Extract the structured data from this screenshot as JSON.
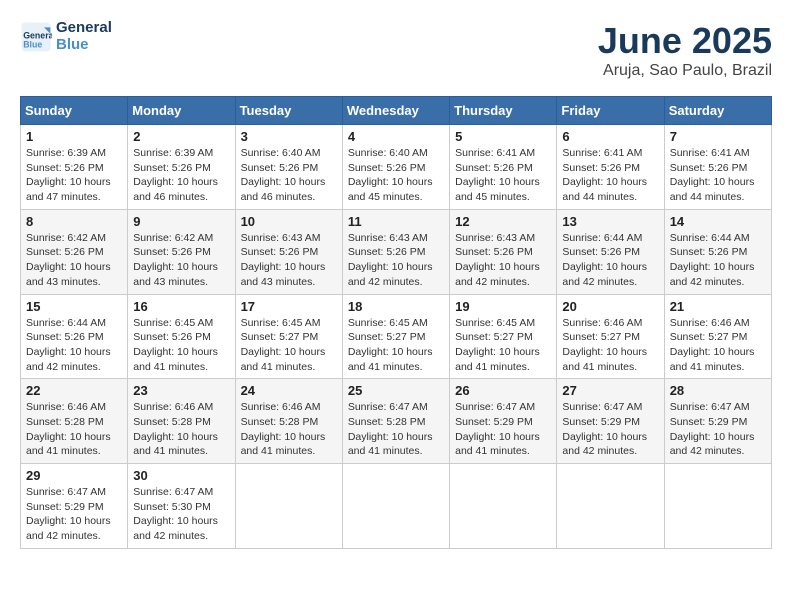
{
  "header": {
    "logo_line1": "General",
    "logo_line2": "Blue",
    "month": "June 2025",
    "location": "Aruja, Sao Paulo, Brazil"
  },
  "days_of_week": [
    "Sunday",
    "Monday",
    "Tuesday",
    "Wednesday",
    "Thursday",
    "Friday",
    "Saturday"
  ],
  "weeks": [
    [
      {
        "day": "1",
        "info": "Sunrise: 6:39 AM\nSunset: 5:26 PM\nDaylight: 10 hours\nand 47 minutes."
      },
      {
        "day": "2",
        "info": "Sunrise: 6:39 AM\nSunset: 5:26 PM\nDaylight: 10 hours\nand 46 minutes."
      },
      {
        "day": "3",
        "info": "Sunrise: 6:40 AM\nSunset: 5:26 PM\nDaylight: 10 hours\nand 46 minutes."
      },
      {
        "day": "4",
        "info": "Sunrise: 6:40 AM\nSunset: 5:26 PM\nDaylight: 10 hours\nand 45 minutes."
      },
      {
        "day": "5",
        "info": "Sunrise: 6:41 AM\nSunset: 5:26 PM\nDaylight: 10 hours\nand 45 minutes."
      },
      {
        "day": "6",
        "info": "Sunrise: 6:41 AM\nSunset: 5:26 PM\nDaylight: 10 hours\nand 44 minutes."
      },
      {
        "day": "7",
        "info": "Sunrise: 6:41 AM\nSunset: 5:26 PM\nDaylight: 10 hours\nand 44 minutes."
      }
    ],
    [
      {
        "day": "8",
        "info": "Sunrise: 6:42 AM\nSunset: 5:26 PM\nDaylight: 10 hours\nand 43 minutes."
      },
      {
        "day": "9",
        "info": "Sunrise: 6:42 AM\nSunset: 5:26 PM\nDaylight: 10 hours\nand 43 minutes."
      },
      {
        "day": "10",
        "info": "Sunrise: 6:43 AM\nSunset: 5:26 PM\nDaylight: 10 hours\nand 43 minutes."
      },
      {
        "day": "11",
        "info": "Sunrise: 6:43 AM\nSunset: 5:26 PM\nDaylight: 10 hours\nand 42 minutes."
      },
      {
        "day": "12",
        "info": "Sunrise: 6:43 AM\nSunset: 5:26 PM\nDaylight: 10 hours\nand 42 minutes."
      },
      {
        "day": "13",
        "info": "Sunrise: 6:44 AM\nSunset: 5:26 PM\nDaylight: 10 hours\nand 42 minutes."
      },
      {
        "day": "14",
        "info": "Sunrise: 6:44 AM\nSunset: 5:26 PM\nDaylight: 10 hours\nand 42 minutes."
      }
    ],
    [
      {
        "day": "15",
        "info": "Sunrise: 6:44 AM\nSunset: 5:26 PM\nDaylight: 10 hours\nand 42 minutes."
      },
      {
        "day": "16",
        "info": "Sunrise: 6:45 AM\nSunset: 5:26 PM\nDaylight: 10 hours\nand 41 minutes."
      },
      {
        "day": "17",
        "info": "Sunrise: 6:45 AM\nSunset: 5:27 PM\nDaylight: 10 hours\nand 41 minutes."
      },
      {
        "day": "18",
        "info": "Sunrise: 6:45 AM\nSunset: 5:27 PM\nDaylight: 10 hours\nand 41 minutes."
      },
      {
        "day": "19",
        "info": "Sunrise: 6:45 AM\nSunset: 5:27 PM\nDaylight: 10 hours\nand 41 minutes."
      },
      {
        "day": "20",
        "info": "Sunrise: 6:46 AM\nSunset: 5:27 PM\nDaylight: 10 hours\nand 41 minutes."
      },
      {
        "day": "21",
        "info": "Sunrise: 6:46 AM\nSunset: 5:27 PM\nDaylight: 10 hours\nand 41 minutes."
      }
    ],
    [
      {
        "day": "22",
        "info": "Sunrise: 6:46 AM\nSunset: 5:28 PM\nDaylight: 10 hours\nand 41 minutes."
      },
      {
        "day": "23",
        "info": "Sunrise: 6:46 AM\nSunset: 5:28 PM\nDaylight: 10 hours\nand 41 minutes."
      },
      {
        "day": "24",
        "info": "Sunrise: 6:46 AM\nSunset: 5:28 PM\nDaylight: 10 hours\nand 41 minutes."
      },
      {
        "day": "25",
        "info": "Sunrise: 6:47 AM\nSunset: 5:28 PM\nDaylight: 10 hours\nand 41 minutes."
      },
      {
        "day": "26",
        "info": "Sunrise: 6:47 AM\nSunset: 5:29 PM\nDaylight: 10 hours\nand 41 minutes."
      },
      {
        "day": "27",
        "info": "Sunrise: 6:47 AM\nSunset: 5:29 PM\nDaylight: 10 hours\nand 42 minutes."
      },
      {
        "day": "28",
        "info": "Sunrise: 6:47 AM\nSunset: 5:29 PM\nDaylight: 10 hours\nand 42 minutes."
      }
    ],
    [
      {
        "day": "29",
        "info": "Sunrise: 6:47 AM\nSunset: 5:29 PM\nDaylight: 10 hours\nand 42 minutes."
      },
      {
        "day": "30",
        "info": "Sunrise: 6:47 AM\nSunset: 5:30 PM\nDaylight: 10 hours\nand 42 minutes."
      },
      {
        "day": "",
        "info": ""
      },
      {
        "day": "",
        "info": ""
      },
      {
        "day": "",
        "info": ""
      },
      {
        "day": "",
        "info": ""
      },
      {
        "day": "",
        "info": ""
      }
    ]
  ]
}
